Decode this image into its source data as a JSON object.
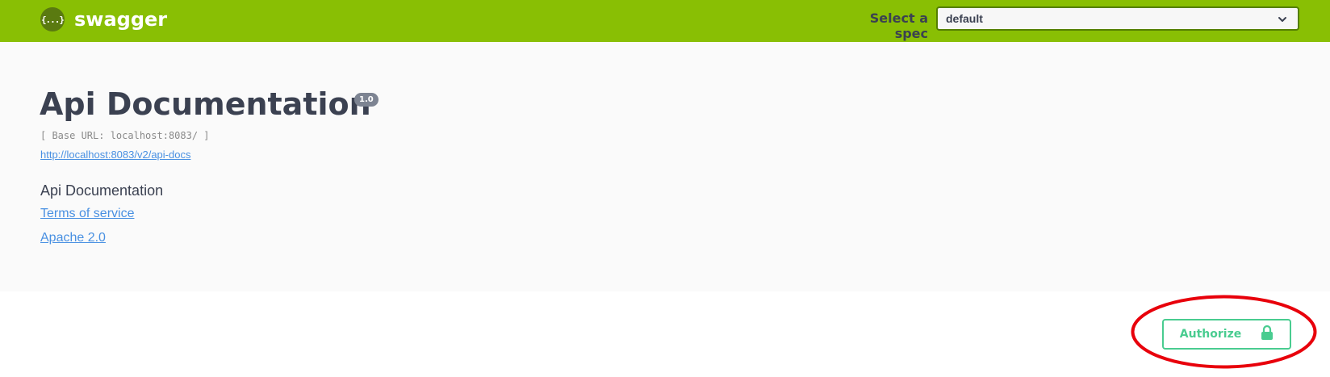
{
  "header": {
    "brand_logo": "{...}",
    "brand_name": "swagger",
    "spec_label": "Select a spec",
    "spec_selected": "default",
    "bg_color": "#89bf04"
  },
  "info": {
    "title": "Api Documentation",
    "version": "1.0",
    "base_url": "[ Base URL: localhost:8083/ ]",
    "docs_url": "http://localhost:8083/v2/api-docs",
    "description": "Api Documentation",
    "terms_link": "Terms of service",
    "license_link": "Apache 2.0"
  },
  "auth": {
    "button_label": "Authorize",
    "icon": "lock-icon",
    "color": "#49cc90"
  },
  "annotation": {
    "shape": "ellipse",
    "color": "#e8000b"
  }
}
